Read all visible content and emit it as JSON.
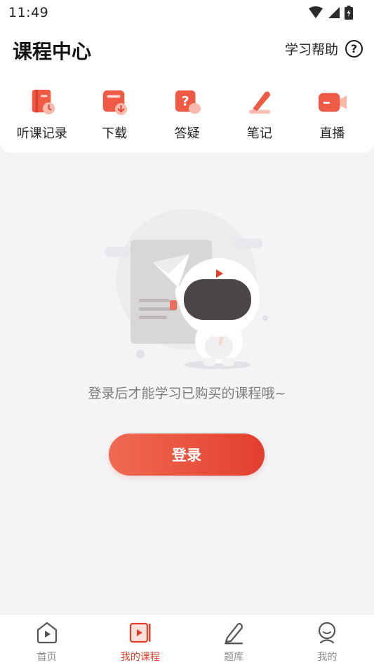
{
  "status_bar": {
    "time": "11:49"
  },
  "header": {
    "title": "课程中心",
    "help_label": "学习帮助",
    "help_symbol": "?"
  },
  "quick_actions": [
    {
      "label": "听课记录",
      "icon": "listening-record-icon"
    },
    {
      "label": "下载",
      "icon": "download-icon"
    },
    {
      "label": "答疑",
      "icon": "qa-icon"
    },
    {
      "label": "笔记",
      "icon": "note-pen-icon"
    },
    {
      "label": "直播",
      "icon": "live-camera-icon"
    }
  ],
  "empty_state": {
    "message": "登录后才能学习已购买的课程哦~",
    "login_label": "登录"
  },
  "bottom_nav": [
    {
      "label": "首页",
      "icon": "home-icon",
      "active": false
    },
    {
      "label": "我的课程",
      "icon": "my-courses-icon",
      "active": true
    },
    {
      "label": "题库",
      "icon": "question-bank-icon",
      "active": false
    },
    {
      "label": "我的",
      "icon": "profile-icon",
      "active": false
    }
  ],
  "colors": {
    "accent": "#e23f2d",
    "accent_light": "#ef6a53",
    "page_background": "#f4f4f6",
    "inactive_nav": "#8c8c8c"
  }
}
